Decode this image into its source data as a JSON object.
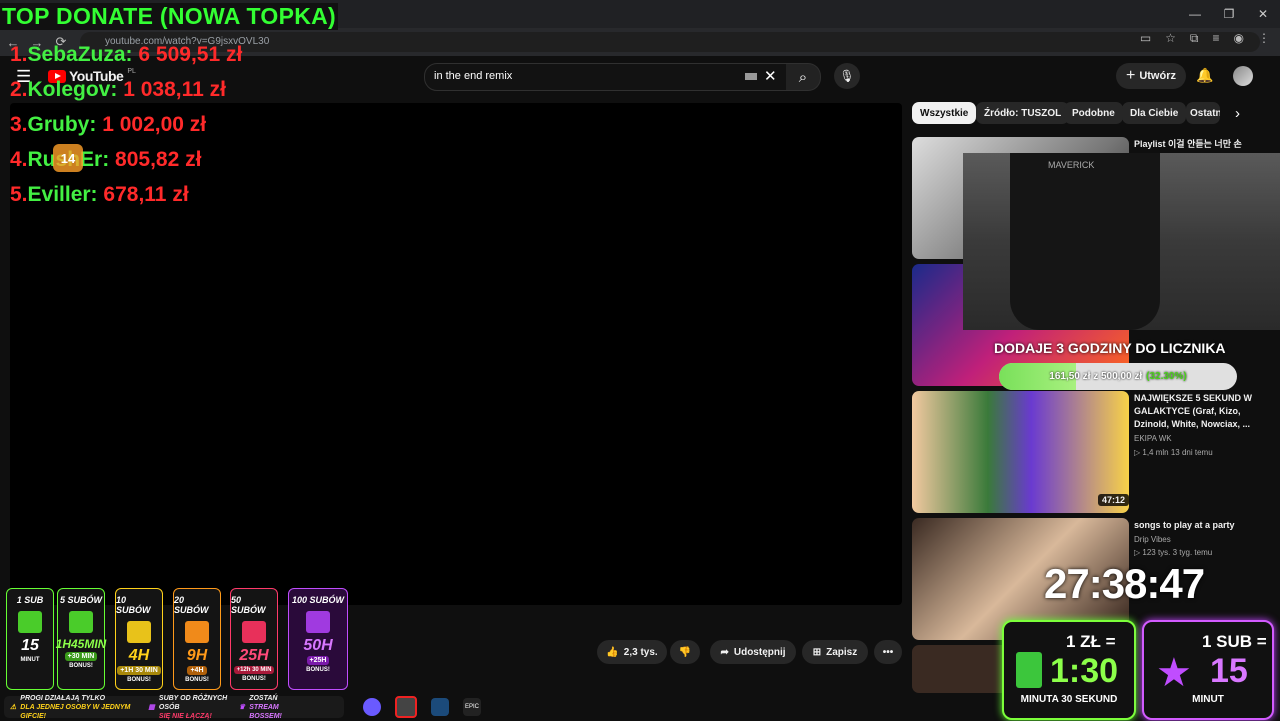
{
  "browser": {
    "url": "youtube.com/watch?v=G9jsxvOVL30",
    "window_controls": [
      "—",
      "❐",
      "✕"
    ],
    "nav": [
      "←",
      "→",
      "⟳"
    ]
  },
  "youtube": {
    "logo_text": "YouTube",
    "region": "PL",
    "search_value": "in the end remix",
    "create_label": "Utwórz"
  },
  "top_donate": {
    "title": "TOP DONATE (NOWA TOPKA)",
    "entries": [
      {
        "rank": "1.",
        "nick": "SebaZuza:",
        "amount": "6 509,51 zł"
      },
      {
        "rank": "2.",
        "nick": "Kolegov:",
        "amount": "1 038,11 zł"
      },
      {
        "rank": "3.",
        "nick": "Gruby:",
        "amount": "1 002,00 zł"
      },
      {
        "rank": "4.",
        "nick": "RushEr:",
        "amount": "805,82 zł"
      },
      {
        "rank": "5.",
        "nick": "Eviller:",
        "amount": "678,11 zł"
      }
    ],
    "badge": "14"
  },
  "chips": [
    "Wszystkie",
    "Źródło: TUSZOL",
    "Podobne",
    "Dla Ciebie",
    "Ostatn"
  ],
  "recommendations": [
    {
      "title": "Playlist 이걸 안듣는 너만 손",
      "channel": "",
      "meta": ""
    },
    {
      "title": "NAJWIĘKSZE 5 SEKUND W GALAKTYCE (Graf, Kizo, Dzinold, White, Nowciax, ...",
      "channel": "EKIPA WK",
      "meta": "▷ 1,4 mln   13 dni temu",
      "duration": "47:12"
    },
    {
      "title": "songs to play at a party",
      "channel": "Drip Vibes",
      "meta": "▷ 123 tys.   3 tyg. temu"
    }
  ],
  "webcam": {
    "shirt_text": "MAVERICK"
  },
  "goal": {
    "title": "DODAJE 3 GODZINY DO LICZNIKA",
    "progress": "161,50 zł z 500,00 zł",
    "percent": "(32.30%)",
    "fraction": 0.323
  },
  "timer": "27:38:47",
  "money_cards": {
    "zl_head": "1 ZŁ =",
    "zl_value": "1:30",
    "zl_foot": "MINUTA 30 SEKUND",
    "sub_head": "1 SUB =",
    "sub_value": "15",
    "sub_foot": "MINUT"
  },
  "player_buttons": {
    "likes": "2,3 tys.",
    "share": "Udostępnij",
    "save": "Zapisz",
    "more": "•••"
  },
  "tiers": [
    {
      "label": "1 SUB",
      "value": "15",
      "extra": "MINUT",
      "bonus": "",
      "color": "#66ff33"
    },
    {
      "label": "5 SUBÓW",
      "value": "1H45MIN",
      "extra": "+30 MIN",
      "bonus": "BONUS!",
      "color": "#66ff33"
    },
    {
      "label": "10 SUBÓW",
      "value": "4H",
      "extra": "+1H 30 MIN",
      "bonus": "BONUS!",
      "color": "#ffd21a"
    },
    {
      "label": "20 SUBÓW",
      "value": "9H",
      "extra": "+4H",
      "bonus": "BONUS!",
      "color": "#ff9a1a"
    },
    {
      "label": "50 SUBÓW",
      "value": "25H",
      "extra": "+12h 30 MIN",
      "bonus": "BONUS!",
      "color": "#ff3a6a"
    },
    {
      "label": "100 SUBÓW",
      "value": "50H",
      "extra": "+25H",
      "bonus": "BONUS!",
      "color": "#c04dff"
    }
  ],
  "info_bar": {
    "left": "PROGI DZIAŁAJĄ TYLKO",
    "left2": "DLA JEDNEJ OSOBY W JEDNYM GIFCIE!",
    "mid": "SUBY OD RÓŻNYCH OSÓB",
    "mid2": "SIĘ NIE ŁĄCZĄ!",
    "right": "ZOSTAŃ",
    "right2": "STREAM BOSSEM!"
  },
  "taskbar_epic": "EPIC"
}
